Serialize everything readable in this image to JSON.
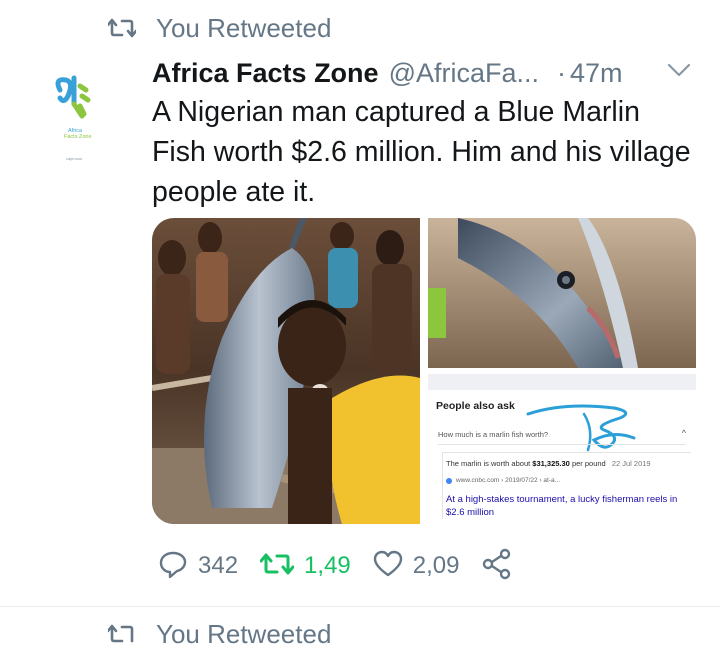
{
  "retweet_banner": {
    "label": "You Retweeted"
  },
  "tweet": {
    "author_name": "Africa Facts Zone",
    "author_handle": "@AfricaFa...",
    "separator": "·",
    "time": "47m",
    "text": "A Nigerian man captured a Blue Marlin Fish worth $2.6 million. Him and his village people ate it.",
    "avatar": {
      "logo_text_1": "Africa",
      "logo_text_2": "Facts Zone",
      "logo_text_3": "cajenoos"
    },
    "media": {
      "search_card": {
        "heading": "People also ask",
        "question": "How much is a marlin fish worth?",
        "answer_prefix": "The marlin is worth about",
        "answer_value": "$31,325.30",
        "answer_suffix": "per pound",
        "answer_date": "22 Jul 2019",
        "source": "www.cnbc.com › 2019/07/22 › at-a...",
        "link_text": "At a high-stakes tournament, a lucky fisherman reels in $2.6 million"
      }
    },
    "actions": {
      "replies": "342",
      "retweets": "1,49",
      "likes": "2,09"
    }
  },
  "next_tweet": {
    "retweet_label": "You Retweeted"
  },
  "colors": {
    "text_primary": "#14171a",
    "text_secondary": "#657786",
    "retweet_green": "#17bf63",
    "link_blue": "#1a0dab",
    "logo_blue": "#3aa0d8",
    "logo_green": "#8cc63f"
  },
  "icons": [
    "retweet-icon",
    "chevron-down-icon",
    "reply-icon",
    "like-icon",
    "share-icon"
  ]
}
